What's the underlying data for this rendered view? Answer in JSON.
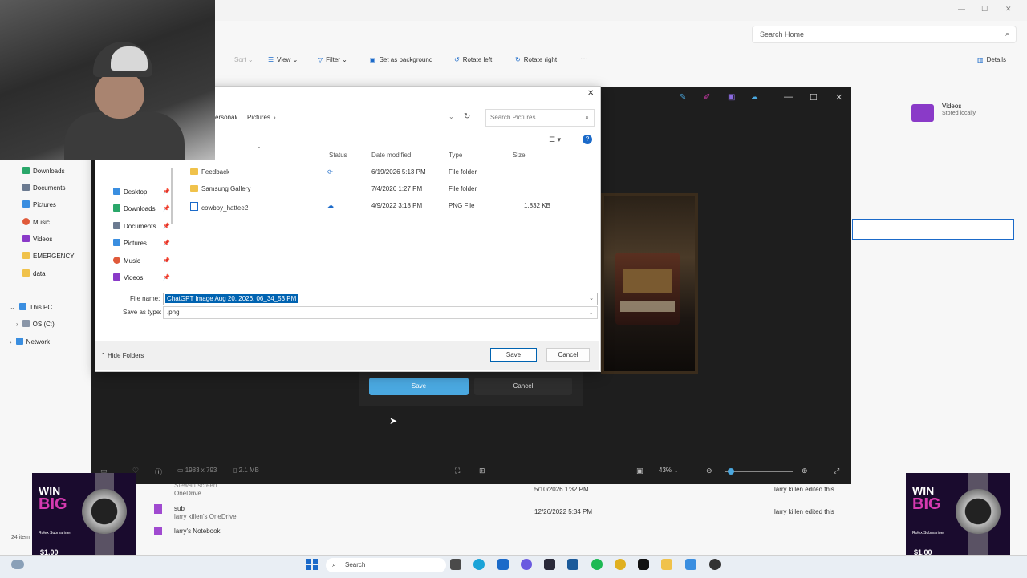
{
  "explorer": {
    "search_placeholder": "Search Home",
    "toolbar": {
      "sort": "Sort",
      "view": "View",
      "filter": "Filter",
      "set_background": "Set as background",
      "rotate_left": "Rotate left",
      "rotate_right": "Rotate right",
      "more": "···",
      "details": "Details"
    },
    "sidebar": [
      "Downloads",
      "Documents",
      "Pictures",
      "Music",
      "Videos",
      "EMERGENCY",
      "data"
    ],
    "this_pc": "This PC",
    "os_drive": "OS (C:)",
    "network": "Network",
    "videos_tile": {
      "title": "Videos",
      "subtitle": "Stored locally"
    },
    "rows": [
      {
        "name": "Stewart screen",
        "sub": "OneDrive",
        "date": "5/10/2026 1:32 PM",
        "activity": "larry killen edited this"
      },
      {
        "name": "sub",
        "sub": "larry killen's OneDrive",
        "date": "12/26/2022 5:34 PM",
        "activity": "larry killen edited this"
      },
      {
        "name": "larry's Notebook",
        "sub": "",
        "date": "",
        "activity": ""
      }
    ],
    "item_count": "24 item"
  },
  "photos": {
    "dimensions": "1983 x 793",
    "filesize": "2.1 MB",
    "zoom": "43%",
    "save_label": "Save",
    "cancel_label": "Cancel"
  },
  "dialog": {
    "breadcrumb": [
      "ersonal",
      "Pictures"
    ],
    "search_placeholder": "Search Pictures",
    "columns": {
      "status": "Status",
      "date": "Date modified",
      "type": "Type",
      "size": "Size"
    },
    "files": [
      {
        "name": "Feedback",
        "kind": "folder",
        "date": "6/19/2026 5:13 PM",
        "type": "File folder",
        "size": ""
      },
      {
        "name": "Samsung Gallery",
        "kind": "folder",
        "date": "7/4/2026 1:27 PM",
        "type": "File folder",
        "size": ""
      },
      {
        "name": "cowboy_hattee2",
        "kind": "png",
        "date": "4/9/2022 3:18 PM",
        "type": "PNG File",
        "size": "1,832 KB"
      }
    ],
    "nav": [
      "Desktop",
      "Downloads",
      "Documents",
      "Pictures",
      "Music",
      "Videos"
    ],
    "file_name_label": "File name:",
    "file_name_value": "ChatGPT Image Aug 20, 2026, 06_34_53 PM",
    "save_type_label": "Save as type:",
    "save_type_value": ".png",
    "hide_folders": "Hide Folders",
    "save_label": "Save",
    "cancel_label": "Cancel"
  },
  "ads": {
    "win": "WIN",
    "big": "BIG",
    "product": "Rolex Submariner",
    "price": "$1.00"
  },
  "taskbar": {
    "search": "Search"
  }
}
